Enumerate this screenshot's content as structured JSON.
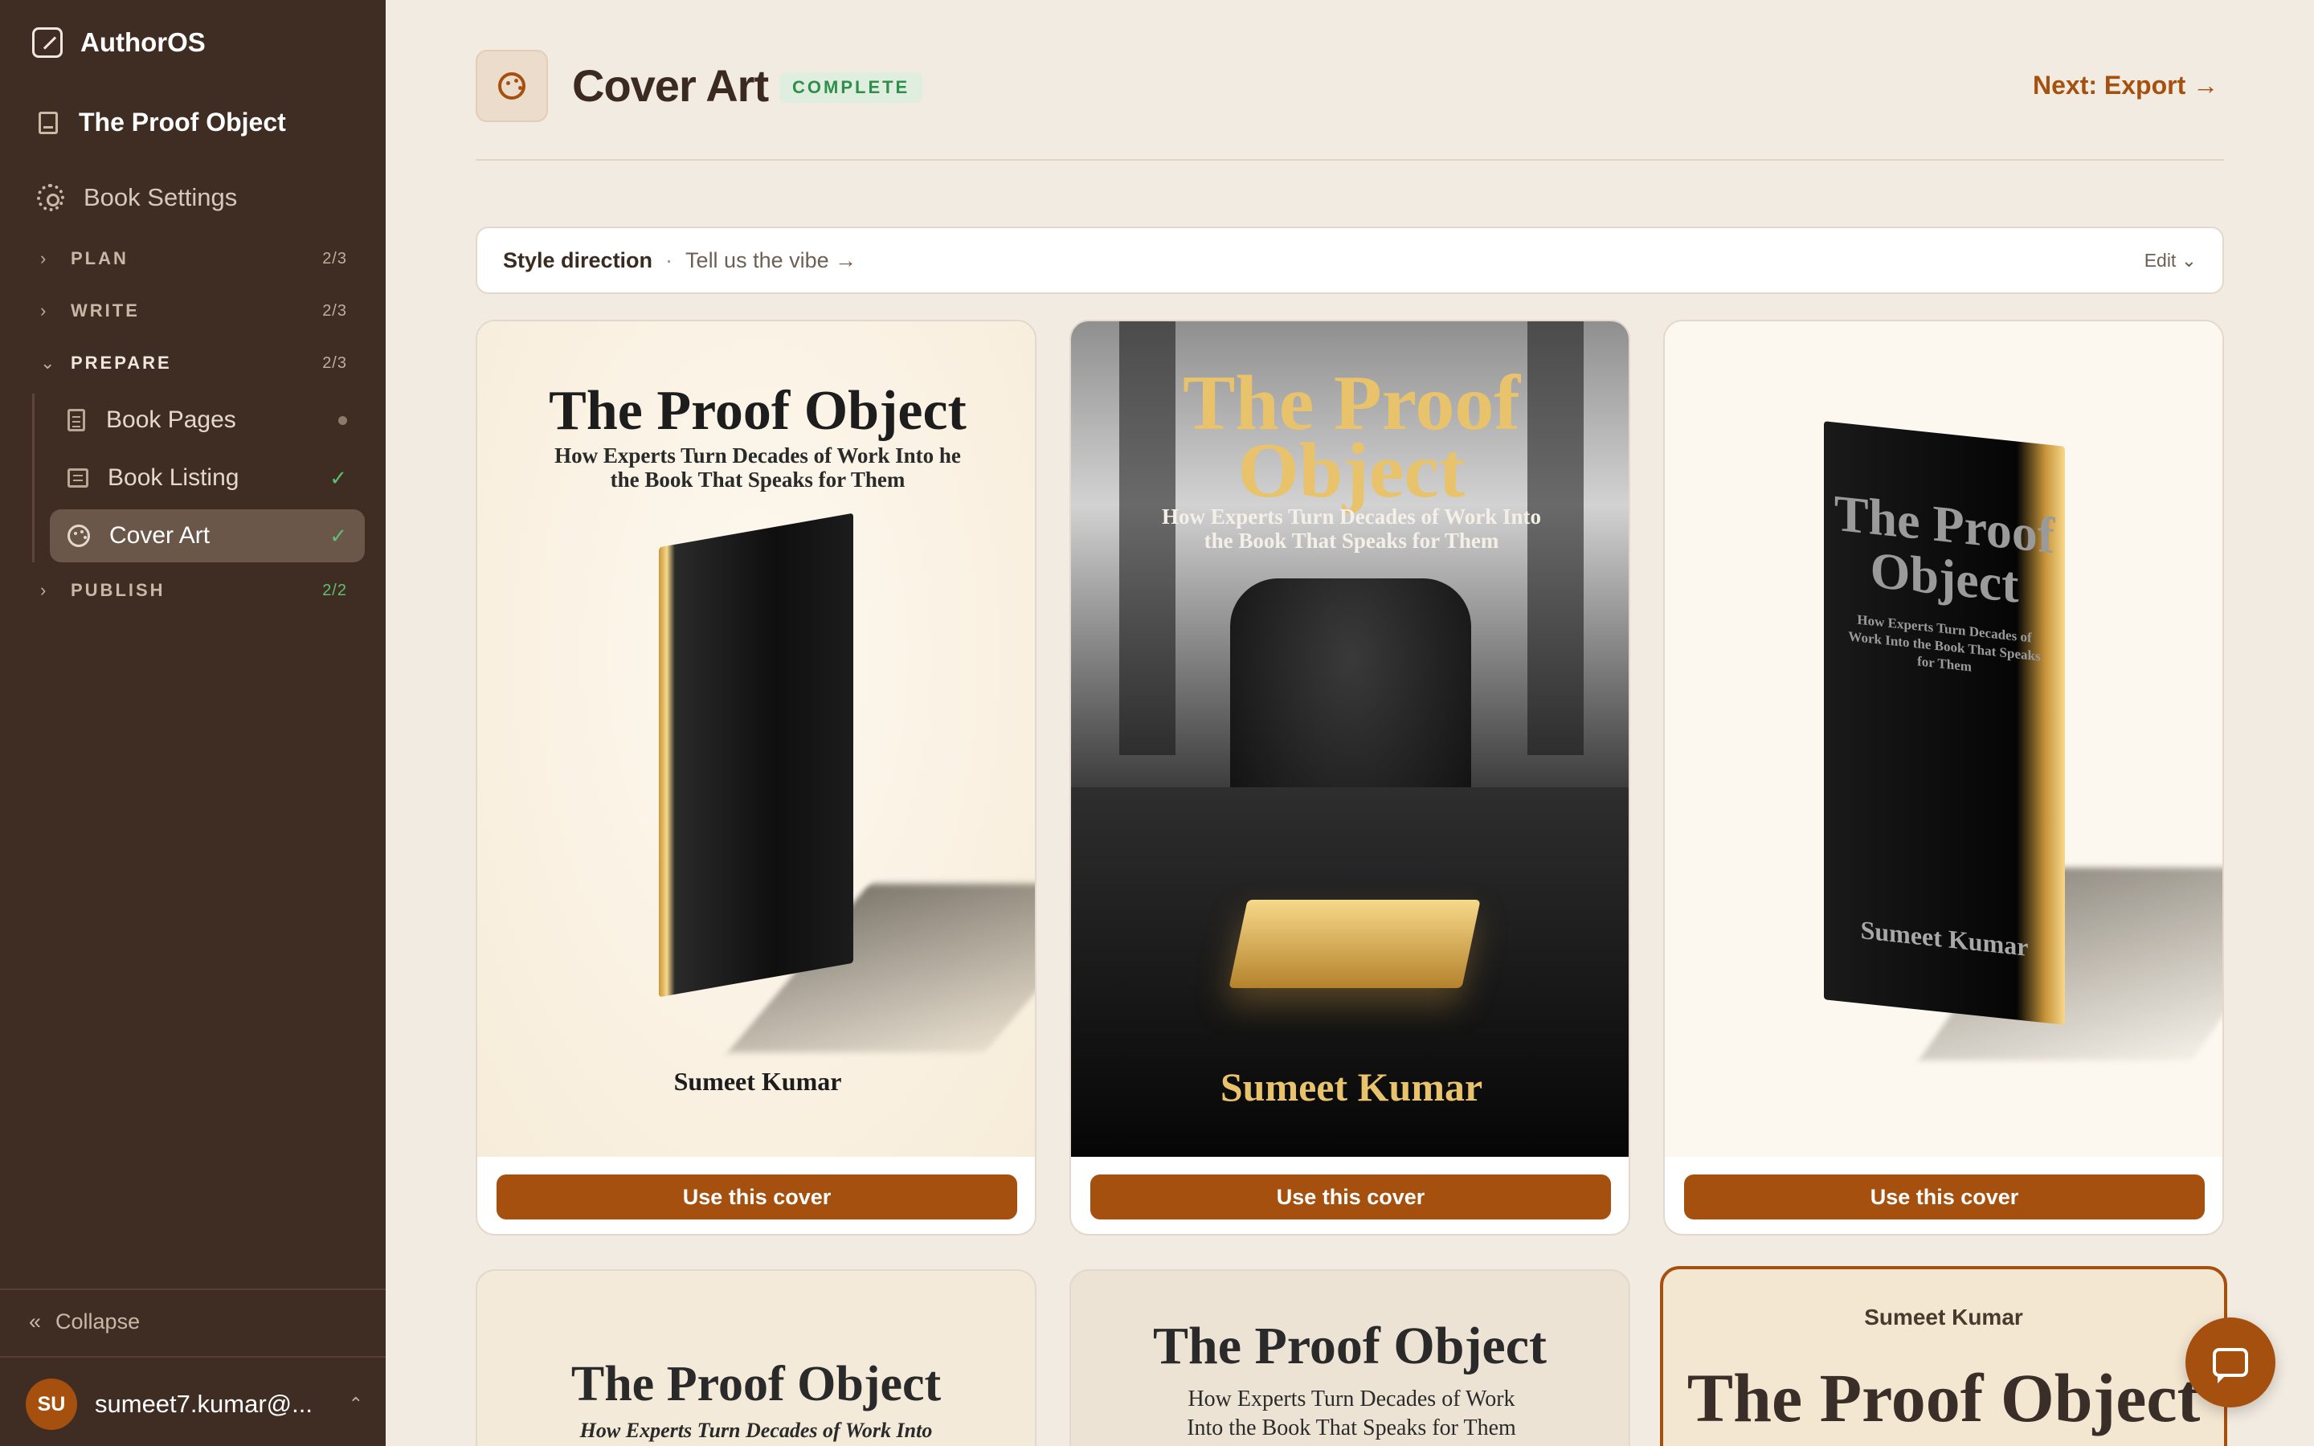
{
  "app": {
    "name": "AuthorOS"
  },
  "sidebar": {
    "book_title": "The Proof Object",
    "settings_label": "Book Settings",
    "sections": [
      {
        "label": "PLAN",
        "count": "2/3"
      },
      {
        "label": "WRITE",
        "count": "2/3"
      },
      {
        "label": "PREPARE",
        "count": "2/3"
      },
      {
        "label": "PUBLISH",
        "count": "2/2"
      }
    ],
    "prepare_items": [
      {
        "label": "Book Pages",
        "status": "in-progress"
      },
      {
        "label": "Book Listing",
        "status": "complete"
      },
      {
        "label": "Cover Art",
        "status": "complete"
      }
    ],
    "collapse_label": "Collapse",
    "user": {
      "initials": "SU",
      "email": "sumeet7.kumar@..."
    }
  },
  "header": {
    "title": "Cover Art",
    "badge": "COMPLETE",
    "next_label": "Next: Export →"
  },
  "style_direction": {
    "label": "Style direction",
    "separator": "·",
    "prompt": "Tell us the vibe →",
    "edit_label": "Edit"
  },
  "covers": [
    {
      "title": "The Proof Object",
      "subtitle": "How Experts Turn Decades of Work Into he the Book That Speaks for Them",
      "author": "Sumeet Kumar",
      "button": "Use this cover"
    },
    {
      "title": "The Proof Object",
      "subtitle": "How Experts Turn Decades of Work Into the Book That Speaks for Them",
      "author": "Sumeet Kumar",
      "button": "Use this cover"
    },
    {
      "title": "The Proof Object",
      "subtitle": "How Experts Turn Decades of Work Into the Book That Speaks for Them",
      "author": "Sumeet Kumar",
      "button": "Use this cover"
    }
  ],
  "covers_row2": [
    {
      "title": "The Proof Object",
      "subtitle": "How Experts Turn Decades of Work Into"
    },
    {
      "title": "The Proof Object",
      "subtitle": "How Experts Turn Decades of Work Into the Book That Speaks for Them"
    },
    {
      "author": "Sumeet Kumar",
      "title": "The Proof Object",
      "selected": true
    }
  ],
  "colors": {
    "accent": "#a6500f",
    "sidebar": "#3f2d23",
    "background": "#f2ebe1",
    "success": "#2f8f4a"
  },
  "icons": {
    "brand": "pencil-square-icon",
    "chat": "chat-bubble-icon",
    "header": "palette-icon"
  }
}
